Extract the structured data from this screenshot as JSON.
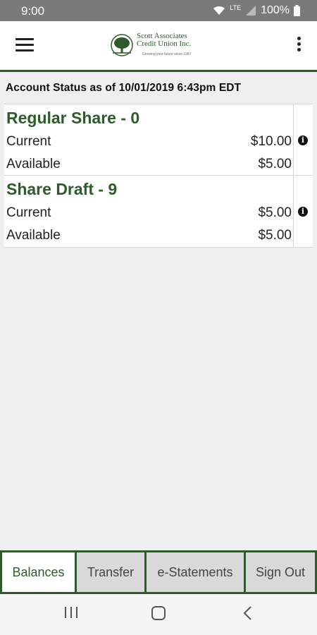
{
  "status_bar": {
    "time": "9:00",
    "network": "LTE",
    "battery": "100%"
  },
  "header": {
    "logo_line1": "Scott Associates",
    "logo_line2": "Credit Union Inc.",
    "logo_tagline": "Growing your future since 1987",
    "brand_color": "#2f5a2c"
  },
  "account_status": "Account Status as of 10/01/2019 6:43pm EDT",
  "accounts": [
    {
      "name": "Regular Share - 0",
      "current_label": "Current",
      "current_value": "$10.00",
      "available_label": "Available",
      "available_value": "$5.00"
    },
    {
      "name": "Share Draft - 9",
      "current_label": "Current",
      "current_value": "$5.00",
      "available_label": "Available",
      "available_value": "$5.00"
    }
  ],
  "tabs": [
    {
      "label": "Balances",
      "active": true
    },
    {
      "label": "Transfer",
      "active": false
    },
    {
      "label": "e-Statements",
      "active": false
    },
    {
      "label": "Sign Out",
      "active": false
    }
  ],
  "icons": {
    "menu": "hamburger-menu-icon",
    "more": "kebab-menu-icon",
    "info": "info-icon",
    "recents": "recents-icon",
    "home": "home-icon",
    "back": "back-icon"
  }
}
